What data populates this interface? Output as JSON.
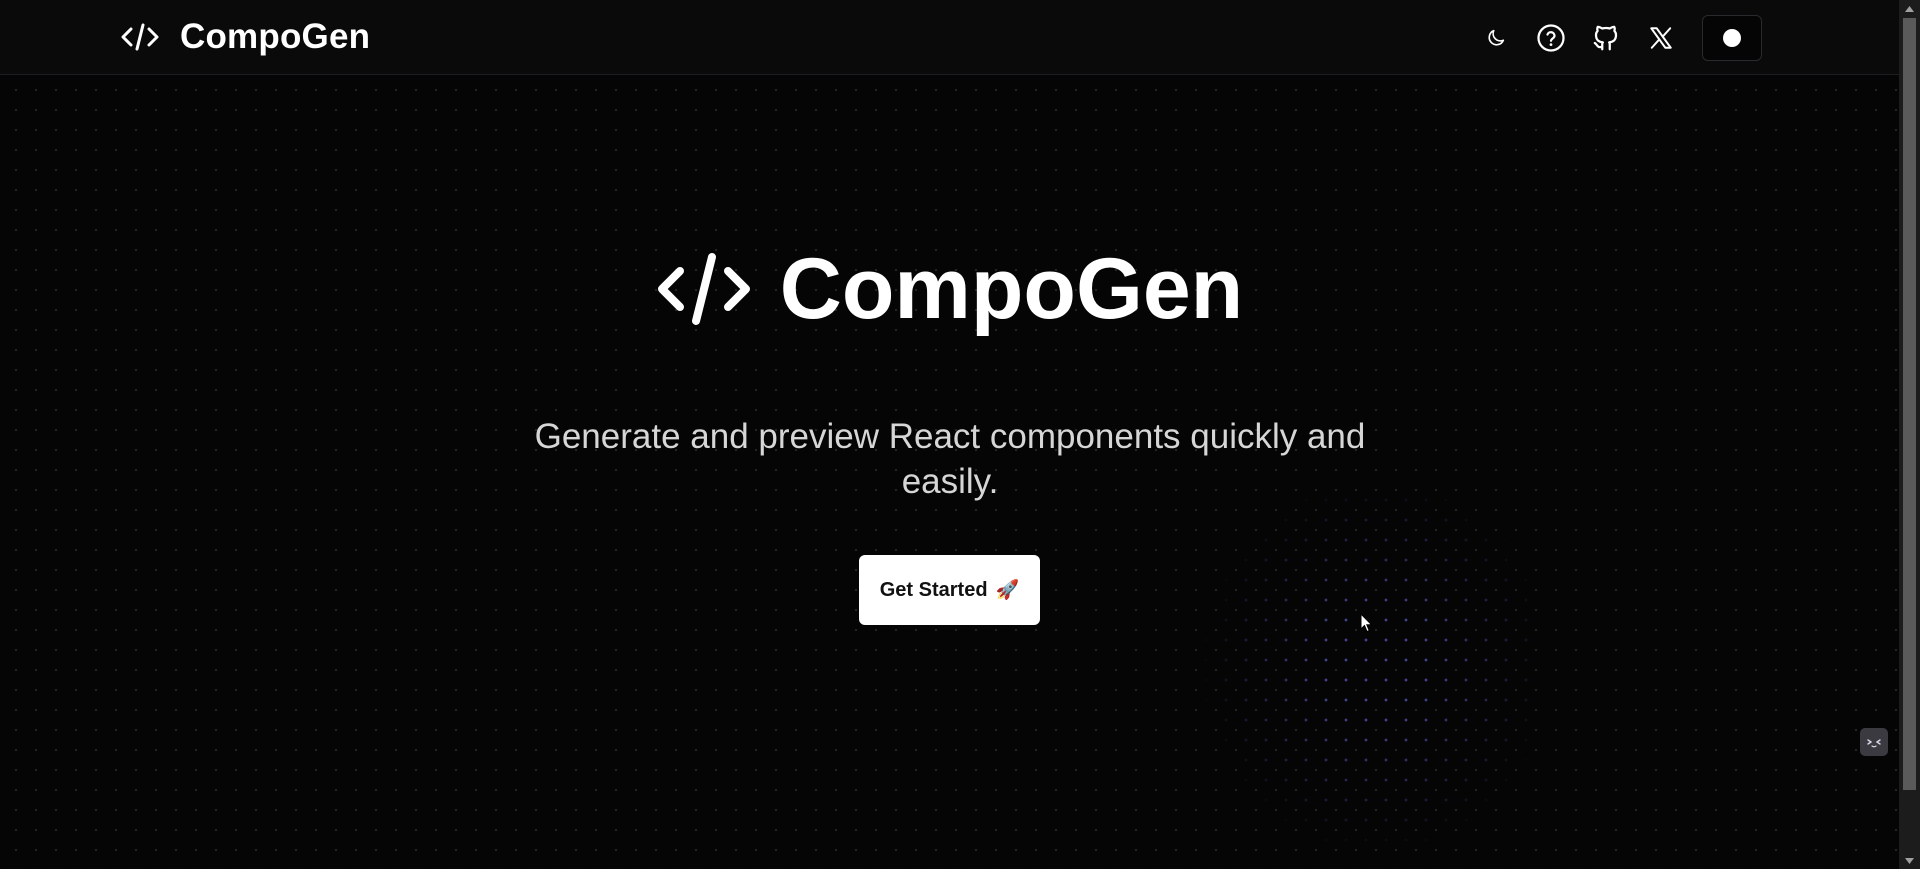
{
  "header": {
    "brand_name": "CompoGen",
    "icons": [
      "code-icon",
      "moon-icon",
      "help-circle-icon",
      "github-icon",
      "x-logo-icon",
      "dot-icon"
    ]
  },
  "hero": {
    "title": "CompoGen",
    "subtitle": "Generate and preview React components quickly and easily.",
    "cta_label": "Get Started",
    "cta_emoji": "🚀"
  },
  "colors": {
    "background": "#050505",
    "header_background": "#0a0a0b",
    "accent_dots": "#7878ff",
    "cta_background": "#ffffff"
  }
}
